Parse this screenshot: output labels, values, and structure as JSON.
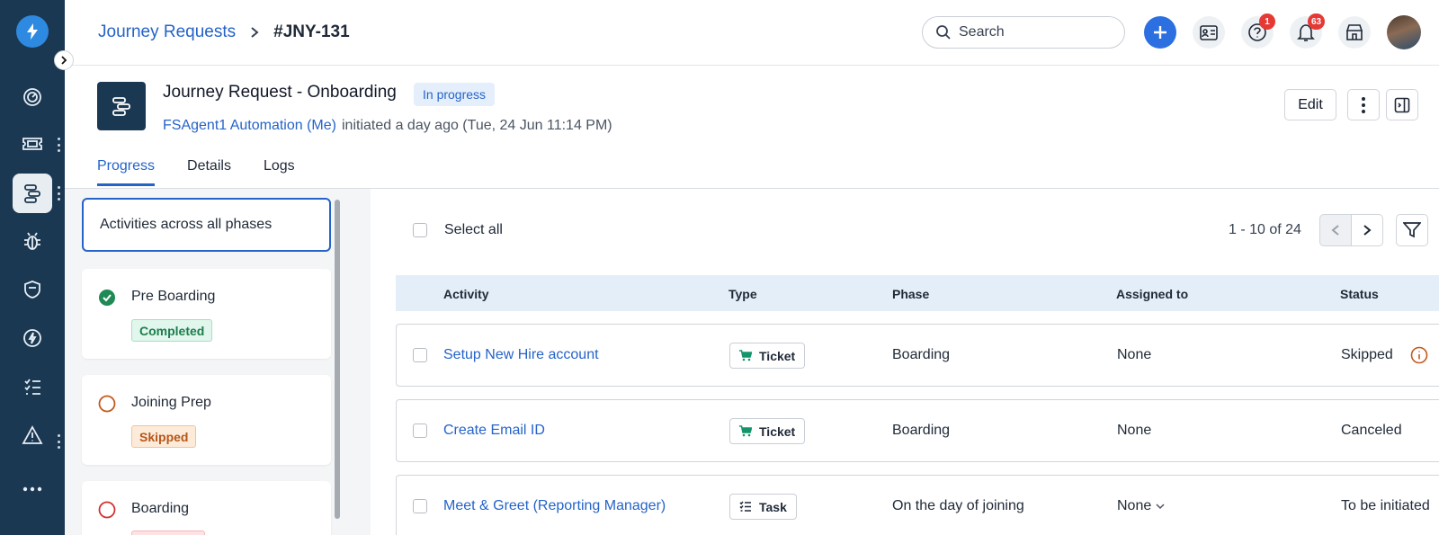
{
  "breadcrumb": {
    "parent": "Journey Requests",
    "current": "#JNY-131"
  },
  "search": {
    "placeholder": "Search"
  },
  "header_badges": {
    "help": "1",
    "notifications": "63"
  },
  "request": {
    "title": "Journey Request - Onboarding",
    "status": "In progress",
    "agent": "FSAgent1 Automation (Me)",
    "initiated": "initiated a day ago (Tue, 24 Jun 11:14 PM)"
  },
  "actions": {
    "edit": "Edit"
  },
  "tabs": [
    {
      "label": "Progress",
      "active": true
    },
    {
      "label": "Details",
      "active": false
    },
    {
      "label": "Logs",
      "active": false
    }
  ],
  "phases": {
    "all_label": "Activities across all phases",
    "items": [
      {
        "name": "Pre Boarding",
        "status": "Completed"
      },
      {
        "name": "Joining Prep",
        "status": "Skipped"
      },
      {
        "name": "Boarding",
        "status": ""
      }
    ]
  },
  "list": {
    "select_all": "Select all",
    "pagination": "1 - 10 of 24",
    "columns": [
      "Activity",
      "Type",
      "Phase",
      "Assigned to",
      "Status"
    ],
    "rows": [
      {
        "activity": "Setup New Hire account",
        "type": "Ticket",
        "phase": "Boarding",
        "assigned": "None",
        "status": "Skipped"
      },
      {
        "activity": "Create Email ID",
        "type": "Ticket",
        "phase": "Boarding",
        "assigned": "None",
        "status": "Canceled"
      },
      {
        "activity": "Meet & Greet (Reporting Manager)",
        "type": "Task",
        "phase": "On the day of joining",
        "assigned": "None",
        "status": "To be initiated"
      }
    ]
  },
  "colors": {
    "sidebar": "#1b3852",
    "accent": "#2563c9",
    "completed": "#1c7d4d",
    "skipped": "#b5561a",
    "error": "#e53935"
  },
  "icons": {
    "logo": "lightning-logo-icon",
    "nav": [
      "dashboard-icon",
      "ticket-icon",
      "journey-icon",
      "bug-icon",
      "shield-icon",
      "bolt-icon",
      "checklist-icon",
      "alert-icon",
      "more-icon"
    ]
  }
}
